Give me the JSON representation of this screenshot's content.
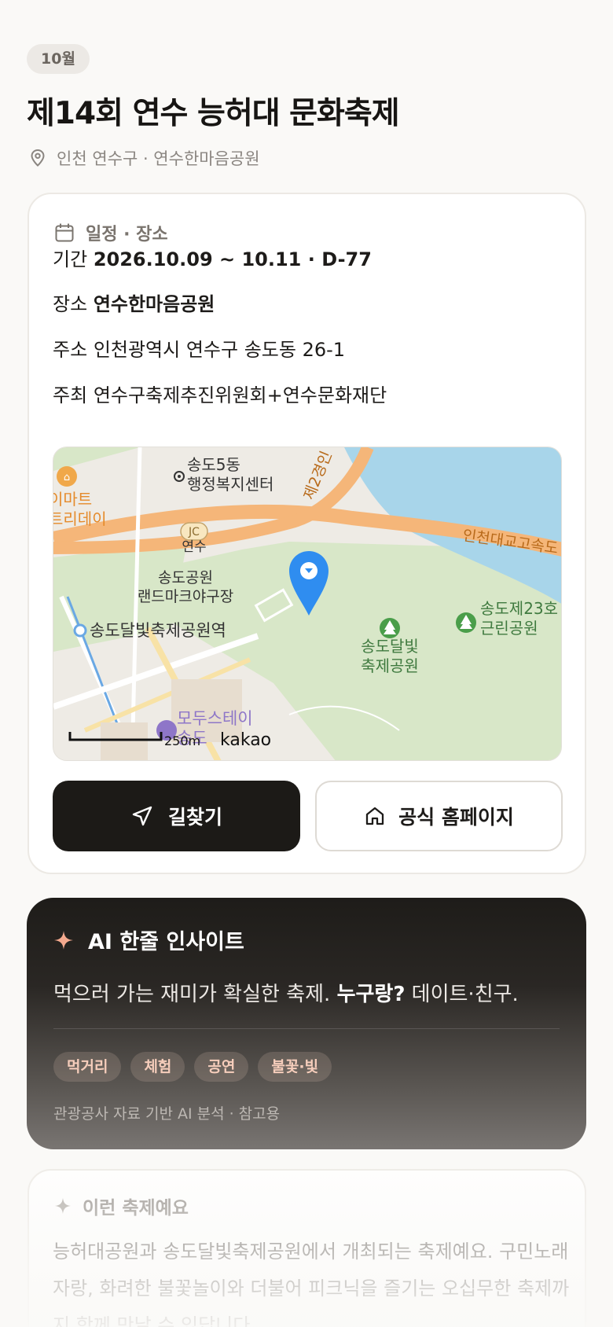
{
  "header": {
    "month": "10월",
    "title": "제14회 연수 능허대 문화축제",
    "location": "인천 연수구 · 연수한마음공원"
  },
  "info": {
    "section_title": "일정 · 장소",
    "period_label": "기간",
    "period_value": "2026.10.09 ~ 10.11 · D-77",
    "venue_label": "장소",
    "venue_value": "연수한마음공원",
    "address_label": "주소",
    "address_value": "인천광역시 연수구 송도동 26-1",
    "host_label": "주최",
    "host_value": "연수구축제추진위원회+연수문화재단"
  },
  "map": {
    "labels": {
      "songdo5": "송도5동",
      "admin_center": "행정복지센터",
      "mart1": "이마트",
      "mart2": "트리데이",
      "jc": "JC",
      "yeonsu": "연수",
      "road2": "제2경인",
      "bridge": "인천대교고속도",
      "park_baseball1": "송도공원",
      "park_baseball2": "랜드마크야구장",
      "station": "송도달빛축제공원역",
      "festival_park1": "송도달빛",
      "festival_park2": "축제공원",
      "neighbor_park1": "송도제23호",
      "neighbor_park2": "근린공원",
      "stay1": "모두스테이",
      "stay2": "송도",
      "scale": "250m",
      "brand": "kakao"
    },
    "colors": {
      "water": "#a8d5ea",
      "park": "#d8e7c8",
      "road": "#f5b679",
      "marker": "#2f8df0"
    }
  },
  "actions": {
    "directions": "길찾기",
    "homepage": "공식 홈페이지"
  },
  "ai": {
    "title": "AI 한줄 인사이트",
    "line_main": "먹으러 가는 재미가 확실한 축제. ",
    "line_bold": "누구랑?",
    "line_tail": " 데이트·친구.",
    "tags": [
      "먹거리",
      "체험",
      "공연",
      "불꽃·빛"
    ],
    "footnote": "관광공사 자료 기반 AI 분석 · 참고용"
  },
  "desc": {
    "title": "이런 축제예요",
    "text": "능허대공원과 송도달빛축제공원에서 개최되는 축제예요. 구민노래자랑, 화려한 불꽃놀이와 더불어 피크닉을 즐기는 오십무한 축제까지 함께 만날 수 있답니다."
  },
  "colors": {
    "accent": "#f4a98e",
    "dark": "#1c1a17"
  }
}
